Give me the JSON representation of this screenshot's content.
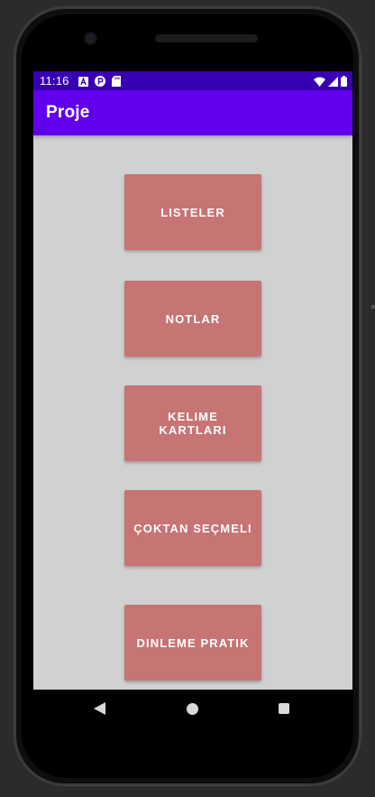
{
  "status_bar": {
    "time": "11:16",
    "left_icons": [
      "a-notification-icon",
      "p-notification-icon",
      "sd-card-icon"
    ],
    "right_icons": [
      "wifi-icon",
      "signal-icon",
      "battery-icon"
    ]
  },
  "app_bar": {
    "title": "Proje",
    "color": "#6200ee"
  },
  "buttons": [
    {
      "label": "LISTELER"
    },
    {
      "label": "NOTLAR"
    },
    {
      "label": "KELIME\nKARTLARI"
    },
    {
      "label": "ÇOKTAN SEÇMELI"
    },
    {
      "label": "DINLEME PRATIK"
    }
  ],
  "colors": {
    "status_bar": "#3700b3",
    "app_bar": "#6200ee",
    "button": "#c67474",
    "background": "#d0d1d1"
  },
  "nav_bar": {
    "icons": [
      "back-icon",
      "home-icon",
      "recent-apps-icon"
    ]
  }
}
